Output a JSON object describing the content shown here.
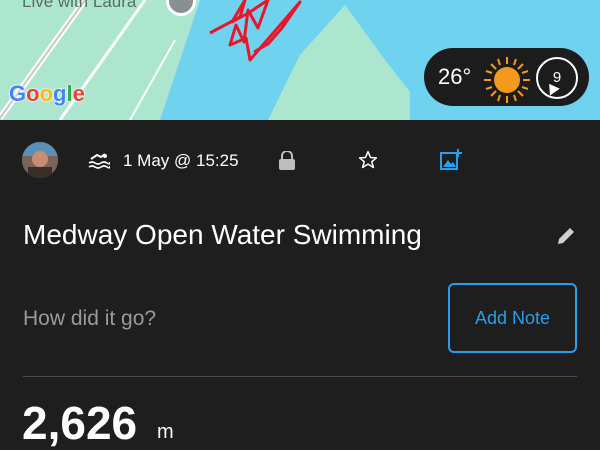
{
  "map": {
    "place_label": "Live with Laura",
    "provider_logo": "Google",
    "colors": {
      "water": "#6fd3f0",
      "land": "#ade6cf",
      "track": "#e8162a"
    }
  },
  "weather": {
    "temperature": "26°",
    "condition_icon": "sun-icon",
    "wind_speed": "9",
    "wind_icon": "wind-direction-icon"
  },
  "activity": {
    "avatar_icon": "avatar",
    "type_icon": "swim-icon",
    "date": "1 May @ 15:25",
    "privacy_icon": "lock-icon",
    "favorite_icon": "star-icon",
    "add_photo_icon": "add-photo-icon",
    "title": "Medway Open Water Swimming",
    "edit_icon": "pencil-icon",
    "note_prompt": "How did it go?",
    "add_note_label": "Add Note",
    "distance_value": "2,626",
    "distance_unit": "m"
  },
  "colors": {
    "background": "#1e1e1e",
    "accent": "#2a9ee8",
    "muted_text": "#9a9a9a"
  }
}
